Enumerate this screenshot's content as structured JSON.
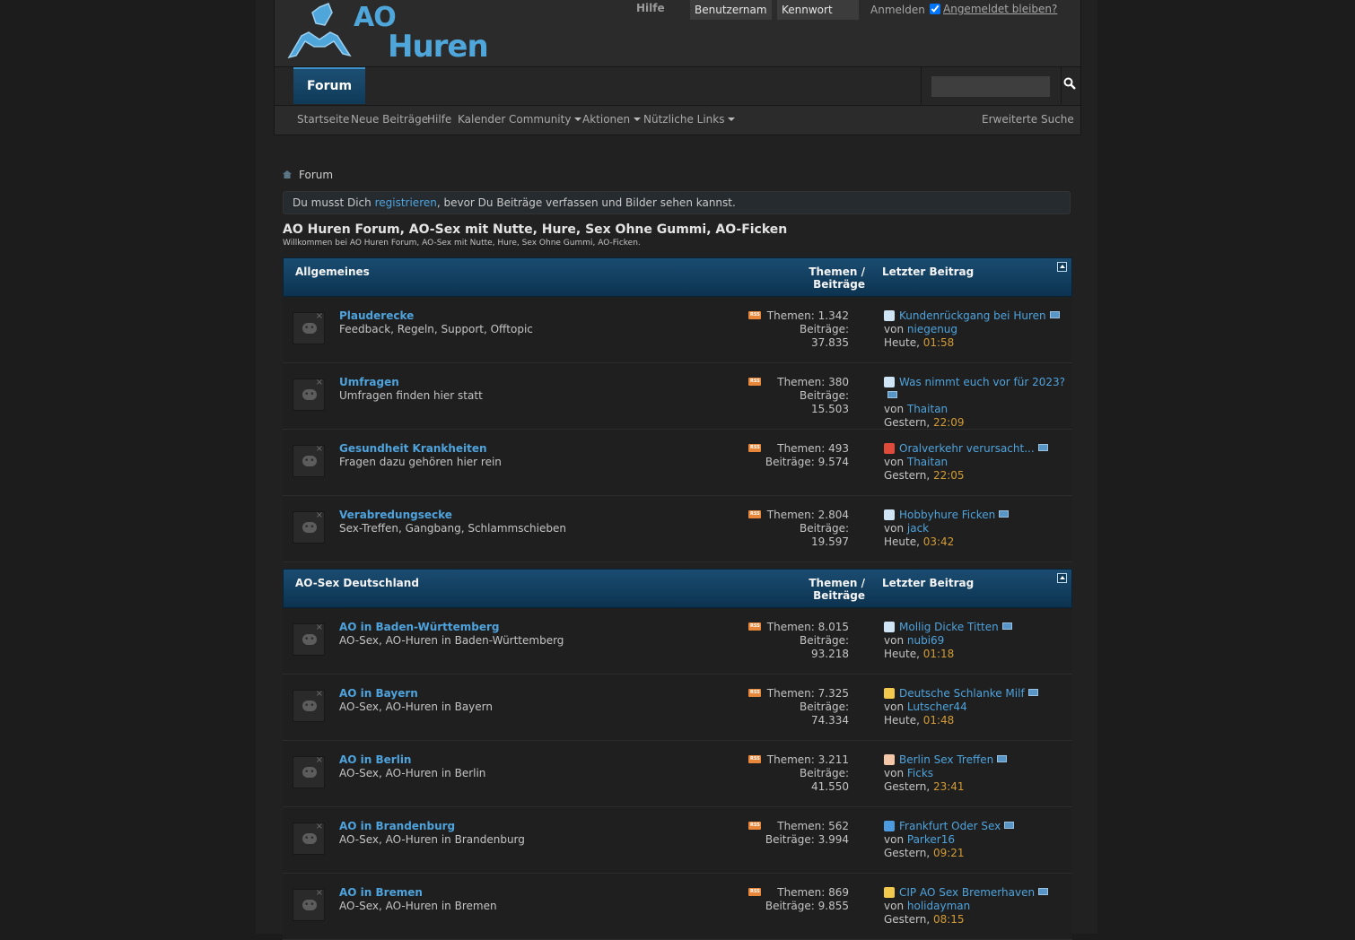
{
  "header": {
    "logo": {
      "line1": "AO",
      "line2": "Huren"
    },
    "login": {
      "help": "Hilfe",
      "username_value": "Benutzername",
      "password_value": "Kennwort",
      "login_button": "Anmelden",
      "remember": "Angemeldet bleiben?"
    },
    "tabs": [
      {
        "label": "Forum"
      }
    ],
    "search_placeholder": "",
    "subnav": {
      "items": [
        "Startseite",
        "Neue Beiträge",
        "Hilfe",
        "Kalender",
        "Community",
        "Aktionen",
        "Nützliche Links"
      ],
      "advanced_search": "Erweiterte Suche"
    }
  },
  "breadcrumb": {
    "label": "Forum"
  },
  "notice": {
    "before": "Du musst Dich ",
    "link": "registrieren",
    "after": ", bevor Du Beiträge verfassen und Bilder sehen kannst."
  },
  "forum": {
    "title": "AO Huren Forum, AO-Sex mit Nutte, Hure, Sex Ohne Gummi, AO-Ficken",
    "description": "Willkommen bei AO Huren Forum, AO-Sex mit Nutte, Hure, Sex Ohne Gummi, AO-Ficken."
  },
  "colors": {
    "accent": "#4ea3dd",
    "time": "#d29b35",
    "header_blue": "#1a4c71",
    "rss": "#e8863a"
  },
  "categories": [
    {
      "name": "Allgemeines",
      "col_threads": "Themen / Beiträge",
      "col_last": "Letzter Beitrag",
      "forums": [
        {
          "name": "Plauderecke",
          "desc": "Feedback, Regeln, Support, Offtopic",
          "stats1": "Themen: 1.342",
          "stats2": "Beiträge:",
          "stats3": "37.835",
          "icon": "document-icon",
          "last_title": "Kundenrückgang bei Huren",
          "by": "von ",
          "user": "niegenug",
          "day": "Heute, ",
          "time": "01:58"
        },
        {
          "name": "Umfragen",
          "desc": "Umfragen finden hier statt",
          "stats1": "Themen: 380",
          "stats2": "Beiträge:",
          "stats3": "15.503",
          "icon": "document-icon",
          "last_title": "Was nimmt euch vor für 2023?",
          "by": "von ",
          "user": "Thaitan",
          "day": "Gestern, ",
          "time": "22:09"
        },
        {
          "name": "Gesundheit Krankheiten",
          "desc": "Fragen dazu gehören hier rein",
          "stats1": "Themen: 493",
          "stats2": "Beiträge: 9.574",
          "stats3": "",
          "icon": "exclamation-icon",
          "last_title": "Oralverkehr verursacht...",
          "by": "von ",
          "user": "Thaitan",
          "day": "Gestern, ",
          "time": "22:05"
        },
        {
          "name": "Verabredungsecke",
          "desc": "Sex-Treffen, Gangbang, Schlammschieben",
          "stats1": "Themen: 2.804",
          "stats2": "Beiträge:",
          "stats3": "19.597",
          "icon": "document-icon",
          "last_title": "Hobbyhure Ficken",
          "by": "von ",
          "user": "jack",
          "day": "Heute, ",
          "time": "03:42"
        }
      ]
    },
    {
      "name": "AO-Sex Deutschland",
      "col_threads": "Themen / Beiträge",
      "col_last": "Letzter Beitrag",
      "forums": [
        {
          "name": "AO in Baden-Württemberg",
          "desc": "AO-Sex, AO-Huren in Baden-Württemberg",
          "stats1": "Themen: 8.015",
          "stats2": "Beiträge:",
          "stats3": "93.218",
          "icon": "document-icon",
          "last_title": "Mollig Dicke Titten",
          "by": "von ",
          "user": "nubi69",
          "day": "Heute, ",
          "time": "01:18"
        },
        {
          "name": "AO in Bayern",
          "desc": "AO-Sex, AO-Huren in Bayern",
          "stats1": "Themen: 7.325",
          "stats2": "Beiträge:",
          "stats3": "74.334",
          "icon": "lightbulb-icon",
          "last_title": "Deutsche Schlanke Milf",
          "by": "von ",
          "user": "Lutscher44",
          "day": "Heute, ",
          "time": "01:48"
        },
        {
          "name": "AO in Berlin",
          "desc": "AO-Sex, AO-Huren in Berlin",
          "stats1": "Themen: 3.211",
          "stats2": "Beiträge:",
          "stats3": "41.550",
          "icon": "thumbs-up-icon",
          "last_title": "Berlin Sex Treffen",
          "by": "von ",
          "user": "Ficks",
          "day": "Gestern, ",
          "time": "23:41"
        },
        {
          "name": "AO in Brandenburg",
          "desc": "AO-Sex, AO-Huren in Brandenburg",
          "stats1": "Themen: 562",
          "stats2": "Beiträge: 3.994",
          "stats3": "",
          "icon": "question-icon",
          "last_title": "Frankfurt Oder Sex",
          "by": "von ",
          "user": "Parker16",
          "day": "Gestern, ",
          "time": "09:21"
        },
        {
          "name": "AO in Bremen",
          "desc": "AO-Sex, AO-Huren in Bremen",
          "stats1": "Themen: 869",
          "stats2": "Beiträge: 9.855",
          "stats3": "",
          "icon": "cool-smiley-icon",
          "last_title": "CIP AO Sex Bremerhaven",
          "by": "von ",
          "user": "holidayman",
          "day": "Gestern, ",
          "time": "08:15"
        }
      ]
    }
  ]
}
